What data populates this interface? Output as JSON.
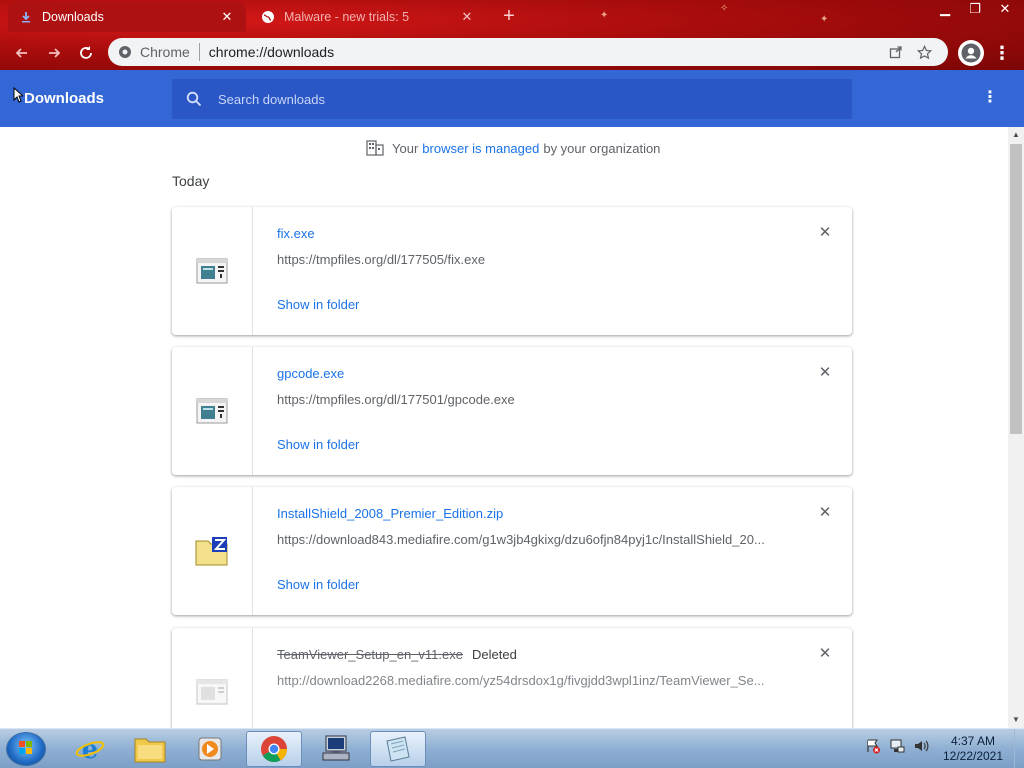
{
  "tabs": [
    {
      "title": "Downloads",
      "active": true,
      "icon": "download-icon"
    },
    {
      "title": "Malware - new trials: 5    ",
      "active": false,
      "icon": "globe-icon"
    }
  ],
  "omnibox": {
    "scheme_label": "Chrome",
    "url": "chrome://downloads"
  },
  "downloads_page": {
    "title": "Downloads",
    "search_placeholder": "Search downloads",
    "managed_notice": {
      "prefix": "Your",
      "link": "browser is managed",
      "suffix": "by your organization"
    },
    "date_group": "Today",
    "items": [
      {
        "name": "fix.exe",
        "url": "https://tmpfiles.org/dl/177505/fix.exe",
        "action": "Show in folder",
        "icon": "exe-file-icon",
        "deleted": false
      },
      {
        "name": "gpcode.exe",
        "url": "https://tmpfiles.org/dl/177501/gpcode.exe",
        "action": "Show in folder",
        "icon": "exe-file-icon",
        "deleted": false
      },
      {
        "name": "InstallShield_2008_Premier_Edition.zip",
        "url": "https://download843.mediafire.com/g1w3jb4gkixg/dzu6ofjn84pyj1c/InstallShield_20...",
        "action": "Show in folder",
        "icon": "zip-file-icon",
        "deleted": false
      },
      {
        "name": "TeamViewer_Setup_en_v11.exe",
        "status": "Deleted",
        "url": "http://download2268.mediafire.com/yz54drsdox1g/fivgjdd3wpl1inz/TeamViewer_Se...",
        "icon": "blank-file-icon",
        "deleted": true
      }
    ]
  },
  "taskbar": {
    "apps": [
      "internet-explorer-icon",
      "file-explorer-icon",
      "media-player-icon",
      "chrome-icon",
      "network-computer-icon",
      "notepad-window-icon"
    ],
    "clock_time": "4:37 AM",
    "clock_date": "12/22/2021"
  },
  "colors": {
    "header_blue": "#3367d6",
    "link_blue": "#1a73e8",
    "frame_red": "#a80c0c"
  }
}
